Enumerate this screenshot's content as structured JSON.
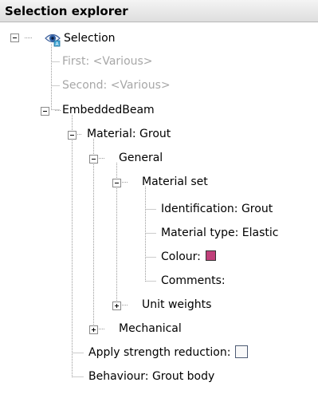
{
  "header": {
    "title": "Selection explorer"
  },
  "tree": {
    "selection": {
      "label": "Selection",
      "icon": "eye-icon",
      "expanded": true
    },
    "first": {
      "label": "First: <Various>"
    },
    "second": {
      "label": "Second: <Various>"
    },
    "embedded_beam": {
      "label": "EmbeddedBeam",
      "expanded": true
    },
    "material": {
      "label": "Material: Grout",
      "expanded": true
    },
    "general": {
      "label": "General",
      "expanded": true
    },
    "material_set": {
      "label": "Material set",
      "expanded": true
    },
    "identification": {
      "label": "Identification: Grout"
    },
    "material_type": {
      "label": "Material type: Elastic"
    },
    "colour": {
      "label": "Colour:",
      "swatch_color": "#c0407a"
    },
    "comments": {
      "label": "Comments:"
    },
    "unit_weights": {
      "label": "Unit weights",
      "expanded": false
    },
    "mechanical": {
      "label": "Mechanical",
      "expanded": false
    },
    "apply_strength_reduction": {
      "label": "Apply strength reduction:",
      "checked": false
    },
    "behaviour": {
      "label": "Behaviour: Grout body"
    }
  }
}
